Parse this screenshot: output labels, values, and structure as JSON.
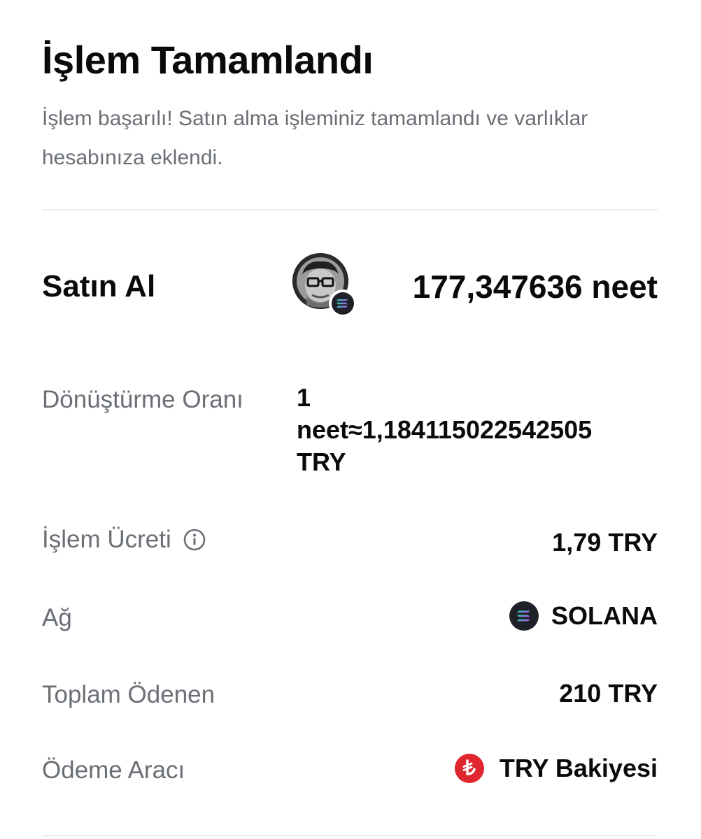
{
  "header": {
    "title": "İşlem Tamamlandı",
    "subtitle": "İşlem başarılı! Satın alma işleminiz tamamlandı ve varlıklar hesabınıza eklendi."
  },
  "summary": {
    "action_label": "Satın Al",
    "amount": "177,347636 neet",
    "token_avatar_icon": "neet-token-avatar",
    "chain_badge_icon": "solana-icon"
  },
  "details": {
    "conversion_rate": {
      "label": "Dönüştürme Oranı",
      "value_lines": [
        "1",
        "neet≈1,184115022542505",
        "TRY"
      ]
    },
    "fee": {
      "label": "İşlem Ücreti",
      "info_icon": "info-icon",
      "value": "1,79 TRY"
    },
    "network": {
      "label": "Ağ",
      "icon": "solana-icon",
      "value": "SOLANA"
    },
    "total_paid": {
      "label": "Toplam Ödenen",
      "value": "210 TRY"
    },
    "payment_method": {
      "label": "Ödeme Aracı",
      "icon": "turkish-lira-icon",
      "value": "TRY Bakiyesi"
    }
  },
  "colors": {
    "text_primary": "#0a0a0a",
    "text_secondary": "#6a6f76",
    "divider": "#ececec",
    "lira_red": "#e0262f",
    "solana_bg": "#1f2128"
  }
}
